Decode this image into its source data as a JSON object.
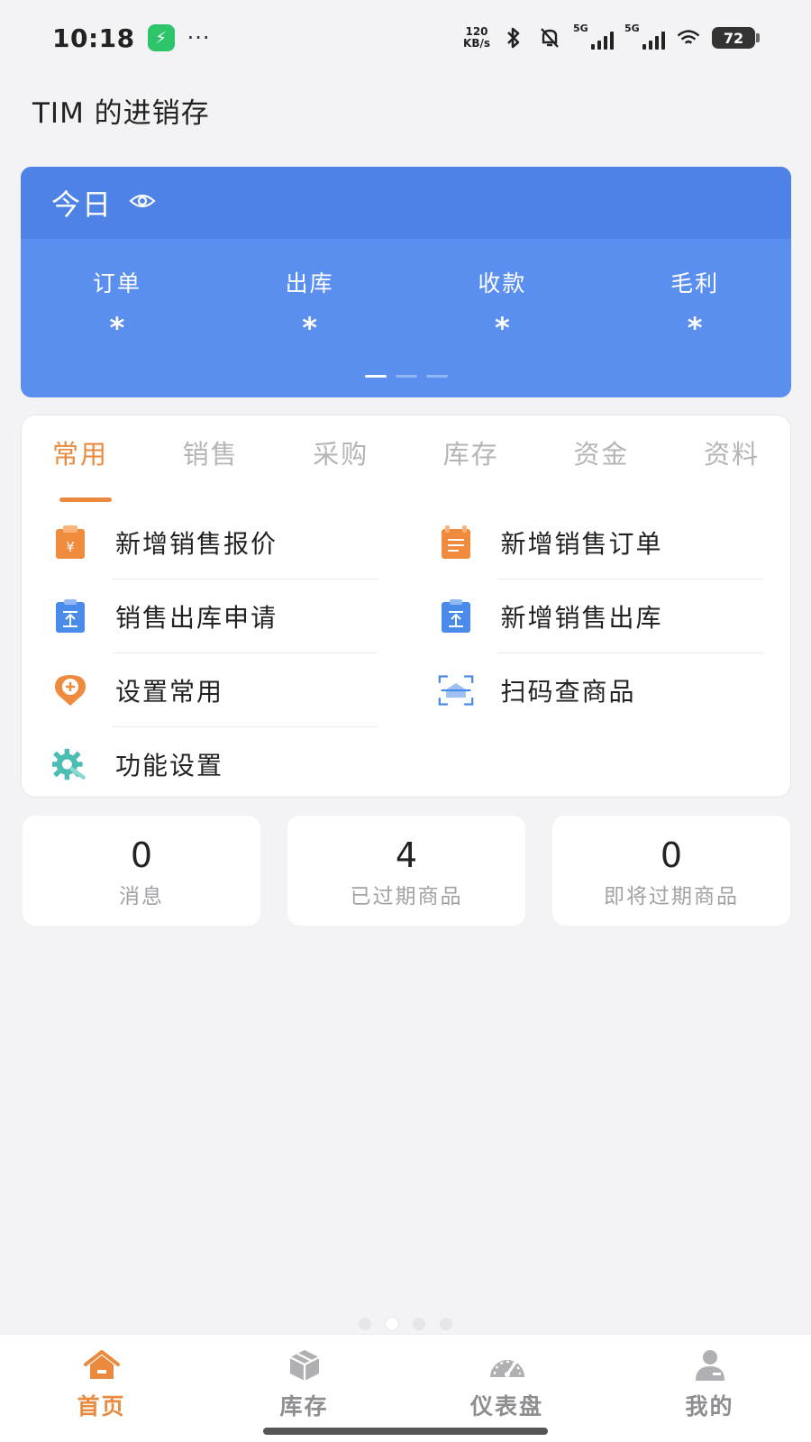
{
  "status_bar": {
    "time": "10:18",
    "speed_value": "120",
    "speed_unit": "KB/s",
    "signal_1": "5G",
    "signal_2": "5G",
    "battery": "72"
  },
  "header": {
    "title": "TIM 的进销存"
  },
  "today": {
    "label": "今日",
    "stats": [
      {
        "label": "订单",
        "value": "*"
      },
      {
        "label": "出库",
        "value": "*"
      },
      {
        "label": "收款",
        "value": "*"
      },
      {
        "label": "毛利",
        "value": "*"
      }
    ]
  },
  "tabs": [
    "常用",
    "销售",
    "采购",
    "库存",
    "资金",
    "资料"
  ],
  "functions": [
    {
      "label": "新增销售报价",
      "icon": "quote-icon"
    },
    {
      "label": "新增销售订单",
      "icon": "order-icon"
    },
    {
      "label": "销售出库申请",
      "icon": "outbound-request-icon"
    },
    {
      "label": "新增销售出库",
      "icon": "outbound-icon"
    },
    {
      "label": "设置常用",
      "icon": "pin-add-icon"
    },
    {
      "label": "扫码查商品",
      "icon": "scan-icon"
    },
    {
      "label": "功能设置",
      "icon": "gear-icon"
    }
  ],
  "tiles": [
    {
      "num": "0",
      "label": "消息"
    },
    {
      "num": "4",
      "label": "已过期商品"
    },
    {
      "num": "0",
      "label": "即将过期商品"
    }
  ],
  "nav": [
    {
      "label": "首页",
      "icon": "home-icon"
    },
    {
      "label": "库存",
      "icon": "box-icon"
    },
    {
      "label": "仪表盘",
      "icon": "dashboard-icon"
    },
    {
      "label": "我的",
      "icon": "user-icon"
    }
  ],
  "colors": {
    "accent": "#e98a3e",
    "card_blue": "#5a8ff0",
    "card_blue_dark": "#4f82e6",
    "icon_blue": "#4a8bea"
  }
}
